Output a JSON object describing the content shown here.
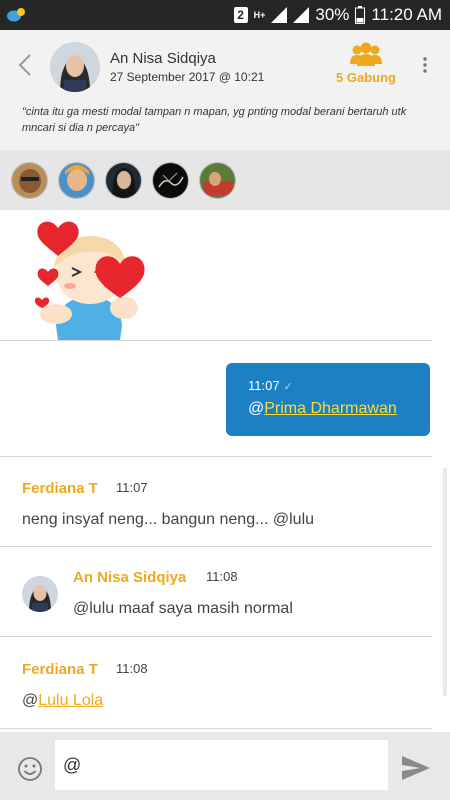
{
  "status_bar": {
    "sim_badge": "2",
    "network": "H+",
    "battery": "30%",
    "time": "11:20 AM"
  },
  "header": {
    "name": "An Nisa Sidqiya",
    "date": "27 September 2017 @ 10:21",
    "join_label": "5 Gabung",
    "quote": "\"cinta itu ga mesti modal tampan n mapan, yg pnting modal berani bertaruh utk mncari si dia n percaya\""
  },
  "members": [
    {
      "name": "member-1"
    },
    {
      "name": "member-2"
    },
    {
      "name": "member-3"
    },
    {
      "name": "member-4"
    },
    {
      "name": "member-5"
    }
  ],
  "chat": {
    "outgoing": {
      "time": "11:07",
      "check": "✓",
      "at": "@",
      "mention": "Prima Dharmawan"
    },
    "messages": [
      {
        "sender": "Ferdiana T",
        "time": "11:07",
        "text": "neng insyaf neng... bangun neng... @lulu"
      },
      {
        "sender": "An Nisa Sidqiya",
        "time": "11:08",
        "text": "@lulu maaf saya masih normal"
      },
      {
        "sender": "Ferdiana T",
        "time": "11:08",
        "at": "@",
        "mention": "Lulu Lola"
      }
    ]
  },
  "input": {
    "value": "@"
  },
  "colors": {
    "accent": "#f0a81c",
    "bubble": "#1d80c2",
    "status_bar": "#262626",
    "header_bg": "#f2f2f2"
  }
}
